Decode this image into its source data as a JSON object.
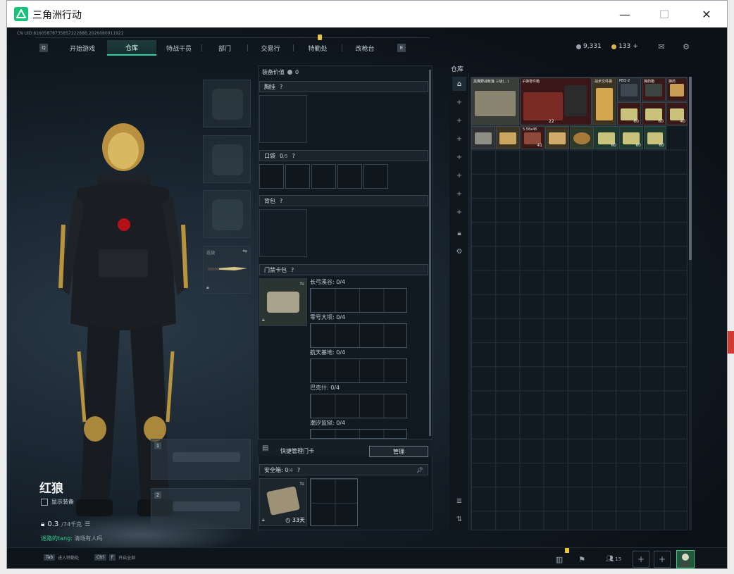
{
  "window": {
    "title": "三角洲行动",
    "minimize": "—",
    "maximize": "☐",
    "close": "✕"
  },
  "uid": "CN UID:8160587873585722288B,2026080011922",
  "nav": {
    "left_key": "Q",
    "right_key": "E",
    "tabs": [
      "开始游戏",
      "仓库",
      "特战干员",
      "部门",
      "交易行",
      "特勤处",
      "改枪台"
    ],
    "active": "仓库"
  },
  "currency": {
    "gray": "9,331",
    "gold": "133",
    "add": "+"
  },
  "character": {
    "name": "红狼",
    "show_equipment": "显示装备",
    "weight_value": "0.3",
    "weight_max": "/74千克",
    "chat_name": "迷路的tang:",
    "chat_text": "清场有人吗"
  },
  "melee_label": "近战",
  "weapon_slots": [
    "1",
    "2"
  ],
  "mid": {
    "equip_value_label": "装备价值",
    "equip_value": "0",
    "chest_label": "胸挂",
    "pocket_label": "口袋",
    "pocket_count": "0",
    "pocket_cap": "/5",
    "backpack_label": "背包",
    "keycard_label": "门禁卡包",
    "keycard_maps": [
      {
        "name": "长弓溪谷",
        "count": "0/4"
      },
      {
        "name": "零号大坝",
        "count": "0/4"
      },
      {
        "name": "航天基地",
        "count": "0/4"
      },
      {
        "name": "巴克什",
        "count": "0/4"
      },
      {
        "name": "潮汐监狱",
        "count": "0/4"
      }
    ],
    "quick_manage": "快捷管理门卡",
    "manage_btn": "管理",
    "safebox_label": "安全箱",
    "safebox_count": "0",
    "safebox_cap": "/4",
    "safebox_days": "33天",
    "q_mark": "?"
  },
  "warehouse": {
    "label": "仓库",
    "items": [
      {
        "name": "黑鹰野战帐篷 三级(...)",
        "qty": "",
        "color": "#3a3d38"
      },
      {
        "name": "子弹零件箱",
        "qty": "22",
        "color": "#3b1616"
      },
      {
        "name": "战术文件袋",
        "qty": "",
        "color": "#3e3520"
      },
      {
        "name": "PEQ-2",
        "qty": "",
        "color": "#252a30"
      },
      {
        "name": "弹药箱",
        "qty": "",
        "color": "#3a1818"
      },
      {
        "name": "弹药",
        "qty": "",
        "color": "#3a1818"
      },
      {
        "name": "",
        "qty": "60",
        "color": "#3a1818"
      },
      {
        "name": "",
        "qty": "60",
        "color": "#3a1818"
      },
      {
        "name": "",
        "qty": "40",
        "color": "#3a1818"
      },
      {
        "name": "",
        "qty": "",
        "color": "#2f3134"
      },
      {
        "name": "",
        "qty": "",
        "color": "#3a3420"
      },
      {
        "name": "5.56x45",
        "qty": "41",
        "color": "#3a1818"
      },
      {
        "name": "",
        "qty": "",
        "color": "#3a3420"
      },
      {
        "name": "",
        "qty": "",
        "color": "#2d3a2a"
      },
      {
        "name": "",
        "qty": "60",
        "color": "#1c3a2e"
      },
      {
        "name": "",
        "qty": "60",
        "color": "#1c3a2e"
      },
      {
        "name": "",
        "qty": "60",
        "color": "#1c3a2e"
      }
    ]
  },
  "bottom": {
    "tab_key": "Tab",
    "tab_hint": "进入特勤处",
    "ctrl_key": "Ctrl",
    "ctrl_key2": "F",
    "ctrl_hint": "开启全部",
    "friends": "15",
    "plus": "+"
  },
  "colors": {
    "accent": "#27d3a0",
    "gold": "#d9b44a",
    "panel": "#121a21"
  }
}
